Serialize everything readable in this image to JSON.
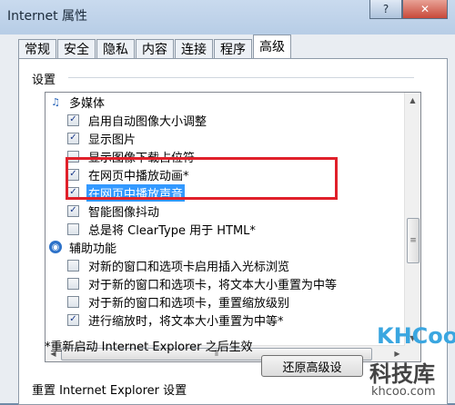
{
  "window": {
    "title": "Internet 属性",
    "minimize": "?",
    "close": "✕"
  },
  "tabs": [
    "常规",
    "安全",
    "隐私",
    "内容",
    "连接",
    "程序",
    "高级"
  ],
  "settings_group": "设置",
  "list": [
    {
      "kind": "category",
      "icon": "multimedia-icon",
      "label": "多媒体"
    },
    {
      "kind": "item",
      "checked": true,
      "label": "启用自动图像大小调整"
    },
    {
      "kind": "item",
      "checked": true,
      "label": "显示图片"
    },
    {
      "kind": "item",
      "checked": false,
      "label": "显示图像下载占位符"
    },
    {
      "kind": "item",
      "checked": true,
      "label": "在网页中播放动画*"
    },
    {
      "kind": "item",
      "checked": true,
      "label": "在网页中播放声音",
      "selected": true
    },
    {
      "kind": "item",
      "checked": true,
      "label": "智能图像抖动"
    },
    {
      "kind": "item",
      "checked": false,
      "label": "总是将 ClearType 用于 HTML*"
    },
    {
      "kind": "category",
      "icon": "accessibility-icon",
      "label": "辅助功能"
    },
    {
      "kind": "item",
      "checked": false,
      "label": "对新的窗口和选项卡启用插入光标浏览"
    },
    {
      "kind": "item",
      "checked": false,
      "label": "对于新的窗口和选项卡，将文本大小重置为中等"
    },
    {
      "kind": "item",
      "checked": false,
      "label": "对于新的窗口和选项卡，重置缩放级别"
    },
    {
      "kind": "item",
      "checked": true,
      "label": "进行缩放时，将文本大小重置为中等*"
    }
  ],
  "restart_note": "*重新启动 Internet Explorer 之后生效",
  "restore_button": "还原高级设",
  "reset_section": "重置 Internet Explorer 设置",
  "watermark": {
    "logo": "KHCoo",
    "name": "科技库",
    "url": "khcoo.com"
  }
}
